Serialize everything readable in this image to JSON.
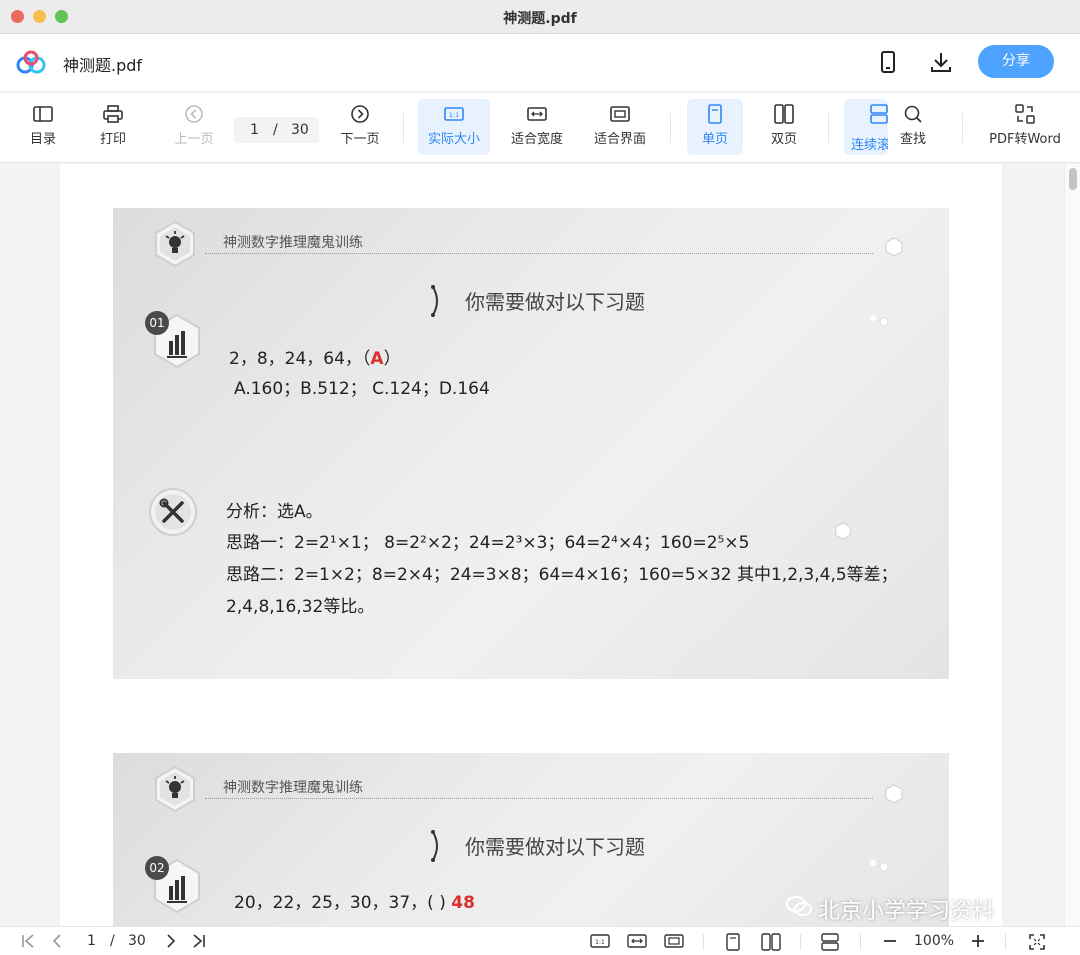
{
  "window": {
    "title": "神测题.pdf"
  },
  "header": {
    "file_name": "神测题.pdf",
    "share_label": "分享"
  },
  "toolbar": {
    "toc": "目录",
    "print": "打印",
    "prev": "上一页",
    "page_current": "1",
    "page_sep": "/",
    "page_total": "30",
    "next": "下一页",
    "actual_size": "实际大小",
    "fit_width": "适合宽度",
    "fit_page": "适合界面",
    "single_page": "单页",
    "double_page": "双页",
    "continuous": "连续滚",
    "find": "查找",
    "pdf_to_word": "PDF转Word",
    "icon_actual": "1:1"
  },
  "slide1": {
    "header": "神测数字推理魔鬼训练",
    "title": "你需要做对以下习题",
    "number": "01",
    "question": "2，8，24，64，（",
    "answer_letter": "A",
    "question_end": "）",
    "options": "A.160；B.512；  C.124；D.164",
    "analysis_1": "分析：选A。",
    "analysis_2": "思路一：2=2¹×1；  8=2²×2；24=2³×3；64=2⁴×4；160=2⁵×5",
    "analysis_3": "思路二：2=1×2；8=2×4；24=3×8；64=4×16；160=5×32 其中1,2,3,4,5等差；",
    "analysis_4": "2,4,8,16,32等比。"
  },
  "slide2": {
    "header": "神测数字推理魔鬼训练",
    "title": "你需要做对以下习题",
    "number": "02",
    "question": "20，22，25，30，37，( )",
    "answer": "48"
  },
  "watermark": "北京小学学习资料",
  "bottombar": {
    "page_current": "1",
    "page_sep": "/",
    "page_total": "30",
    "icon_actual": "1:1",
    "zoom": "100%"
  },
  "colors": {
    "accent": "#2f86f6",
    "share": "#4ea3ff",
    "answer_red": "#d9302c"
  }
}
